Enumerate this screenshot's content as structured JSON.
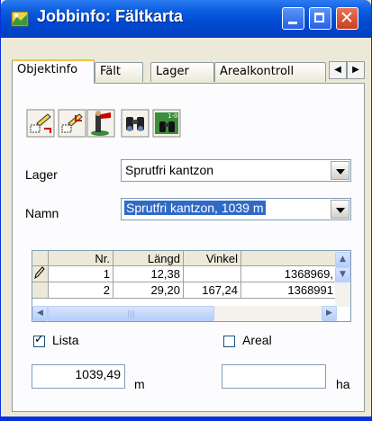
{
  "window": {
    "title": "Jobbinfo: Fältkarta"
  },
  "tabs": [
    {
      "label": "Objektinfo"
    },
    {
      "label": "Fält"
    },
    {
      "label": "Lager"
    },
    {
      "label": "Arealkontroll"
    }
  ],
  "tab_scroll": {
    "left": "◀",
    "right": "▶"
  },
  "toolbar": [
    "edit-feature-icon",
    "edit-feature-2-icon",
    "flag-person-icon",
    "binoculars-icon",
    "map-binoculars-icon"
  ],
  "form": {
    "lager_label": "Lager",
    "lager_value": "Sprutfri kantzon",
    "namn_label": "Namn",
    "namn_value": "Sprutfri kantzon, 1039 m"
  },
  "grid": {
    "columns": [
      "",
      "Nr.",
      "Längd",
      "Vinkel",
      ""
    ],
    "rows": [
      [
        "",
        "1",
        "12,38",
        "",
        "1368969,"
      ],
      [
        "",
        "2",
        "29,20",
        "167,24",
        "1368991"
      ]
    ]
  },
  "options": {
    "lista_label": "Lista",
    "lista_checked": true,
    "areal_label": "Areal",
    "areal_checked": false
  },
  "totals": {
    "length_value": "1039,49",
    "length_unit": "m",
    "area_value": "",
    "area_unit": "ha"
  },
  "colors": {
    "titlebar": "#0a5ce0",
    "selection": "#316ac5",
    "tab_highlight": "#f1c342"
  }
}
